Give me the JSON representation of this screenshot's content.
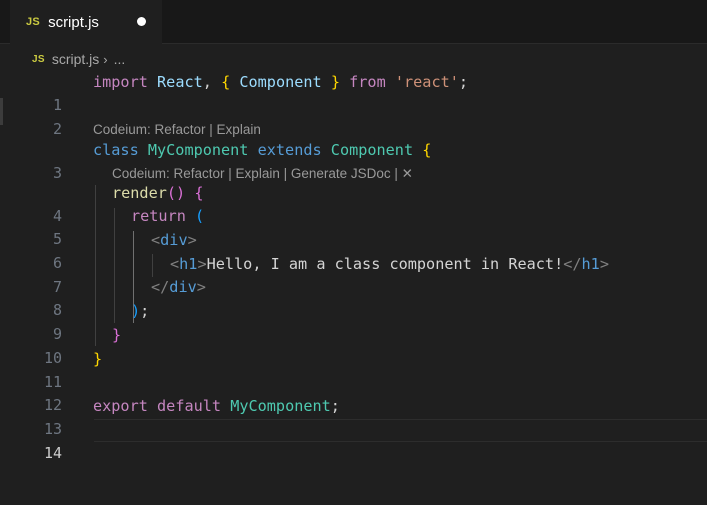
{
  "tab": {
    "icon_label": "JS",
    "filename": "script.js"
  },
  "breadcrumb": {
    "icon_label": "JS",
    "file": "script.js",
    "separator": "›",
    "more": "..."
  },
  "codelens": {
    "line3": "Codeium: Refactor | Explain",
    "line4_text": "Codeium: Refactor | Explain | Generate JSDoc | ",
    "line4_close": "✕"
  },
  "line_numbers": [
    "1",
    "2",
    "3",
    "4",
    "5",
    "6",
    "7",
    "8",
    "9",
    "10",
    "11",
    "12",
    "13",
    "14"
  ],
  "code": {
    "l1": {
      "import": "import",
      "react": "React",
      "comma": ",",
      "ob": "{",
      "component": "Component",
      "cb": "}",
      "from": "from",
      "str": "'react'",
      "semi": ";"
    },
    "l3": {
      "class": "class",
      "name": "MyComponent",
      "extends": "extends",
      "base": "Component",
      "ob": "{"
    },
    "l4": {
      "fn": "render",
      "parens": "()",
      "ob": "{"
    },
    "l5": {
      "return": "return",
      "op": "("
    },
    "l6": {
      "lt": "<",
      "tag": "div",
      "gt": ">"
    },
    "l7": {
      "lt": "<",
      "tag": "h1",
      "gt": ">",
      "text": "Hello, I am a class component in React!",
      "lt2": "</",
      "tag2": "h1",
      "gt2": ">"
    },
    "l8": {
      "lt": "</",
      "tag": "div",
      "gt": ">"
    },
    "l9": {
      "cp": ")",
      "semi": ";"
    },
    "l10": {
      "cb": "}"
    },
    "l11": {
      "cb": "}"
    },
    "l13": {
      "export": "export",
      "default": "default",
      "name": "MyComponent",
      "semi": ";"
    }
  },
  "colors": {
    "background": "#1f1f1f",
    "tabbar": "#181818",
    "keyword": "#c586c0",
    "storage": "#569cd6",
    "class": "#4ec9b0",
    "function": "#dcdcaa",
    "string": "#ce9178",
    "bracket_level1": "#ffd700",
    "bracket_level2": "#da70d6",
    "bracket_level3": "#179fff"
  }
}
